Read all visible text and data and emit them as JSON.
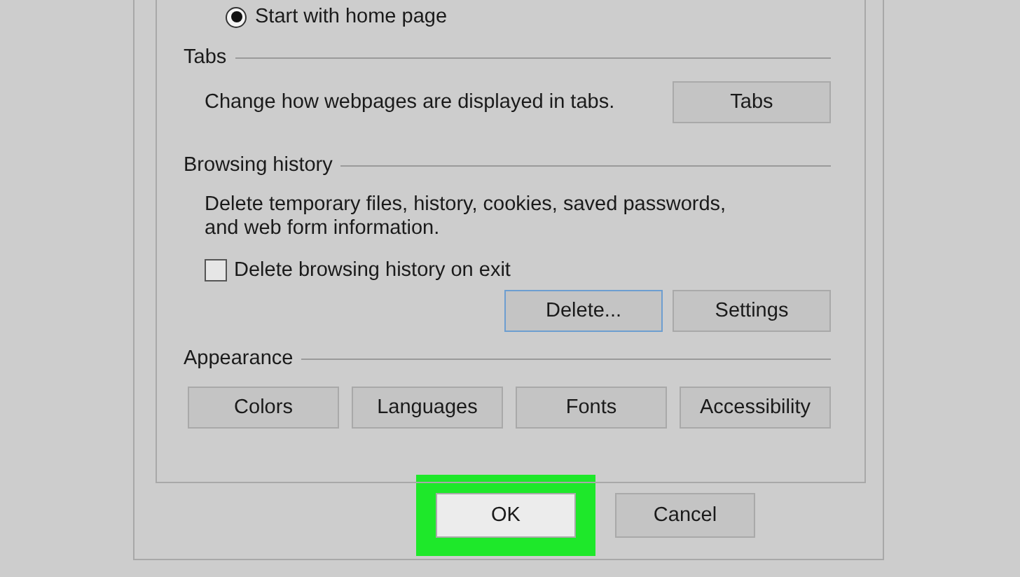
{
  "startup": {
    "radio": {
      "label": "Start with home page",
      "selected": true
    }
  },
  "tabs_section": {
    "title": "Tabs",
    "description": "Change how webpages are displayed in tabs.",
    "button": "Tabs"
  },
  "browsing_history": {
    "title": "Browsing history",
    "description": "Delete temporary files, history, cookies, saved passwords, and web form information.",
    "checkbox": {
      "label": "Delete browsing history on exit",
      "checked": false
    },
    "buttons": [
      {
        "label": "Delete...",
        "focused": true
      },
      {
        "label": "Settings",
        "focused": false
      }
    ]
  },
  "appearance": {
    "title": "Appearance",
    "buttons": [
      "Colors",
      "Languages",
      "Fonts",
      "Accessibility"
    ]
  },
  "footer_buttons": [
    {
      "label": "OK",
      "highlighted": true
    },
    {
      "label": "Cancel",
      "highlighted": false
    }
  ]
}
